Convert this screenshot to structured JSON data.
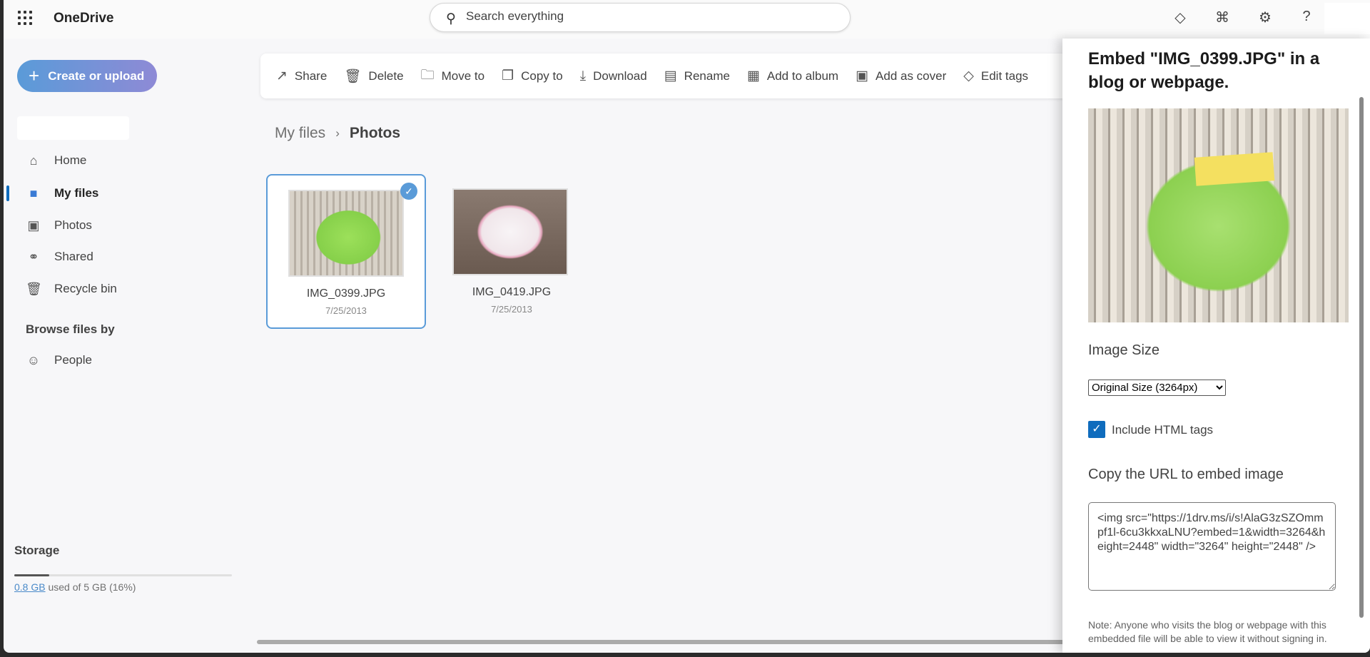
{
  "app": {
    "title": "OneDrive"
  },
  "search": {
    "placeholder": "Search everything"
  },
  "topbar_icons": [
    "premium-diamond-icon",
    "share-connect-icon",
    "settings-gear-icon",
    "help-icon"
  ],
  "sidebar": {
    "create_label": "Create or upload",
    "items": [
      {
        "label": "Home",
        "icon": "home-icon"
      },
      {
        "label": "My files",
        "icon": "folder-icon",
        "selected": true
      },
      {
        "label": "Photos",
        "icon": "photo-icon"
      },
      {
        "label": "Shared",
        "icon": "people-icon"
      },
      {
        "label": "Recycle bin",
        "icon": "trash-icon"
      }
    ],
    "browse_heading": "Browse files by",
    "browse_items": [
      {
        "label": "People",
        "icon": "person-icon"
      }
    ],
    "storage": {
      "title": "Storage",
      "used": "0.8 GB",
      "rest": " used of 5 GB (16%)",
      "percent": 16
    }
  },
  "toolbar": [
    "Share",
    "Delete",
    "Move to",
    "Copy to",
    "Download",
    "Rename",
    "Add to album",
    "Add as cover",
    "Edit tags"
  ],
  "breadcrumb": {
    "parent": "My files",
    "current": "Photos"
  },
  "files": [
    {
      "name": "IMG_0399.JPG",
      "date": "7/25/2013",
      "selected": true
    },
    {
      "name": "IMG_0419.JPG",
      "date": "7/25/2013",
      "selected": false
    }
  ],
  "panel": {
    "title": "Embed \"IMG_0399.JPG\" in a blog or webpage.",
    "image_size_label": "Image Size",
    "image_size_value": "Original Size (3264px)",
    "include_html_label": "Include HTML tags",
    "include_html_checked": true,
    "copy_url_label": "Copy the URL to embed image",
    "embed_code": "<img src=\"https://1drv.ms/i/s!AlaG3zSZOmmpf1l-6cu3kkxaLNU?embed=1&width=3264&height=2448\" width=\"3264\" height=\"2448\" />",
    "note": "Note: Anyone who visits the blog or webpage with this embedded file will be able to view it without signing in."
  },
  "colors": {
    "accent": "#0f6cbd",
    "selection": "#5a9bd8"
  }
}
